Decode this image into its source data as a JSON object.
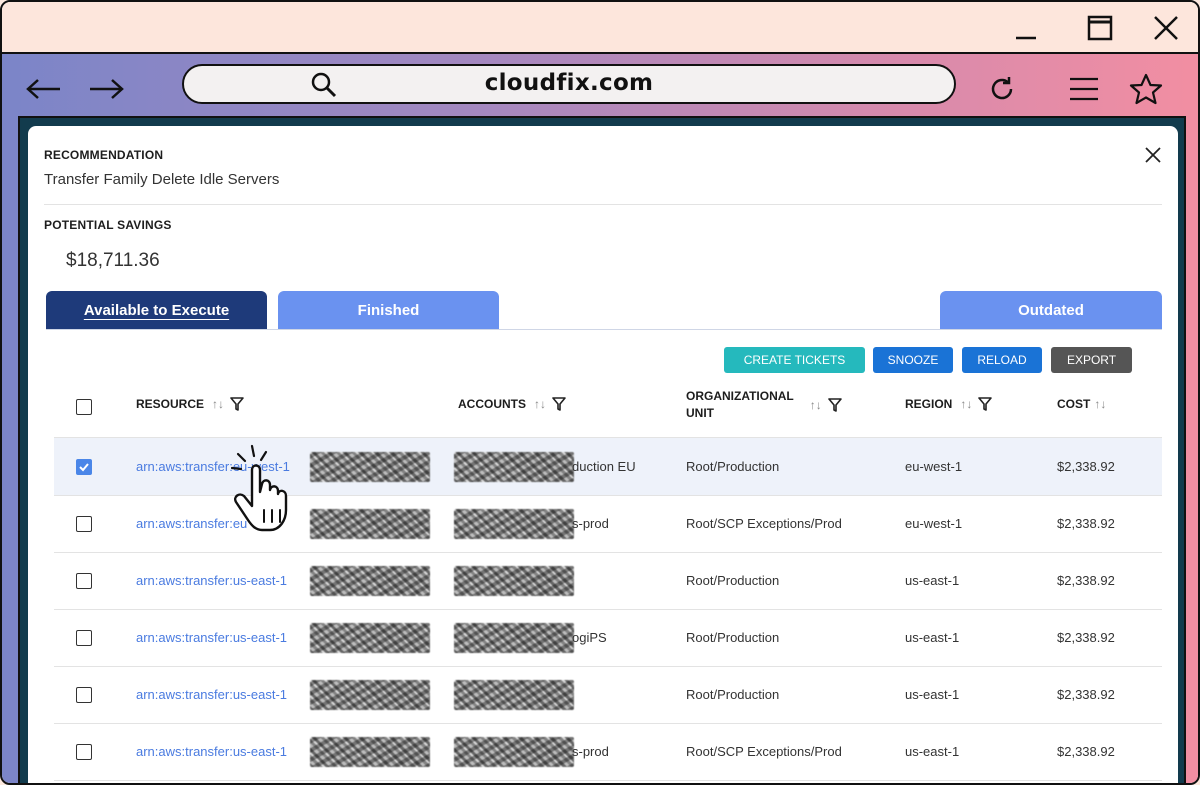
{
  "browser": {
    "url": "cloudfix.com"
  },
  "panel": {
    "recommendation_label": "RECOMMENDATION",
    "recommendation_title": "Transfer Family Delete Idle Servers",
    "savings_label": "POTENTIAL SAVINGS",
    "savings_value": "$18,711.36"
  },
  "tabs": [
    {
      "label": "Available to Execute",
      "active": true
    },
    {
      "label": "Finished",
      "active": false
    },
    {
      "label": "Outdated",
      "active": false
    }
  ],
  "actions": {
    "create_tickets": "CREATE TICKETS",
    "snooze": "SNOOZE",
    "reload": "RELOAD",
    "export": "EXPORT"
  },
  "table": {
    "headers": {
      "resource": "RESOURCE",
      "accounts": "ACCOUNTS",
      "org_unit_1": "ORGANIZATIONAL",
      "org_unit_2": "UNIT",
      "region": "REGION",
      "cost": "COST"
    },
    "sort_glyph": "↑↓",
    "rows": [
      {
        "resource": "arn:aws:transfer:eu-west-1",
        "account": "duction EU",
        "org_unit": "Root/Production",
        "region": "eu-west-1",
        "cost": "$2,338.92",
        "checked": true
      },
      {
        "resource": "arn:aws:transfer:eu",
        "account": "s-prod",
        "org_unit": "Root/SCP Exceptions/Prod",
        "region": "eu-west-1",
        "cost": "$2,338.92",
        "checked": false
      },
      {
        "resource": "arn:aws:transfer:us-east-1",
        "account": "",
        "org_unit": "Root/Production",
        "region": "us-east-1",
        "cost": "$2,338.92",
        "checked": false
      },
      {
        "resource": "arn:aws:transfer:us-east-1",
        "account": "ogiPS",
        "org_unit": "Root/Production",
        "region": "us-east-1",
        "cost": "$2,338.92",
        "checked": false
      },
      {
        "resource": "arn:aws:transfer:us-east-1",
        "account": "",
        "org_unit": "Root/Production",
        "region": "us-east-1",
        "cost": "$2,338.92",
        "checked": false
      },
      {
        "resource": "arn:aws:transfer:us-east-1",
        "account": "s-prod",
        "org_unit": "Root/SCP Exceptions/Prod",
        "region": "us-east-1",
        "cost": "$2,338.92",
        "checked": false
      }
    ]
  },
  "colors": {
    "tab_active": "#1e3a7a",
    "tab_inactive": "#6a92f0",
    "create_tickets": "#25b9bd",
    "primary_button": "#1a73d6",
    "export_button": "#555555",
    "link": "#4a7be0"
  },
  "icons": [
    "minimize-icon",
    "maximize-icon",
    "window-close-icon",
    "back-arrow-icon",
    "forward-arrow-icon",
    "search-icon",
    "refresh-icon",
    "menu-icon",
    "star-icon",
    "close-icon",
    "filter-icon",
    "hand-cursor-icon"
  ]
}
